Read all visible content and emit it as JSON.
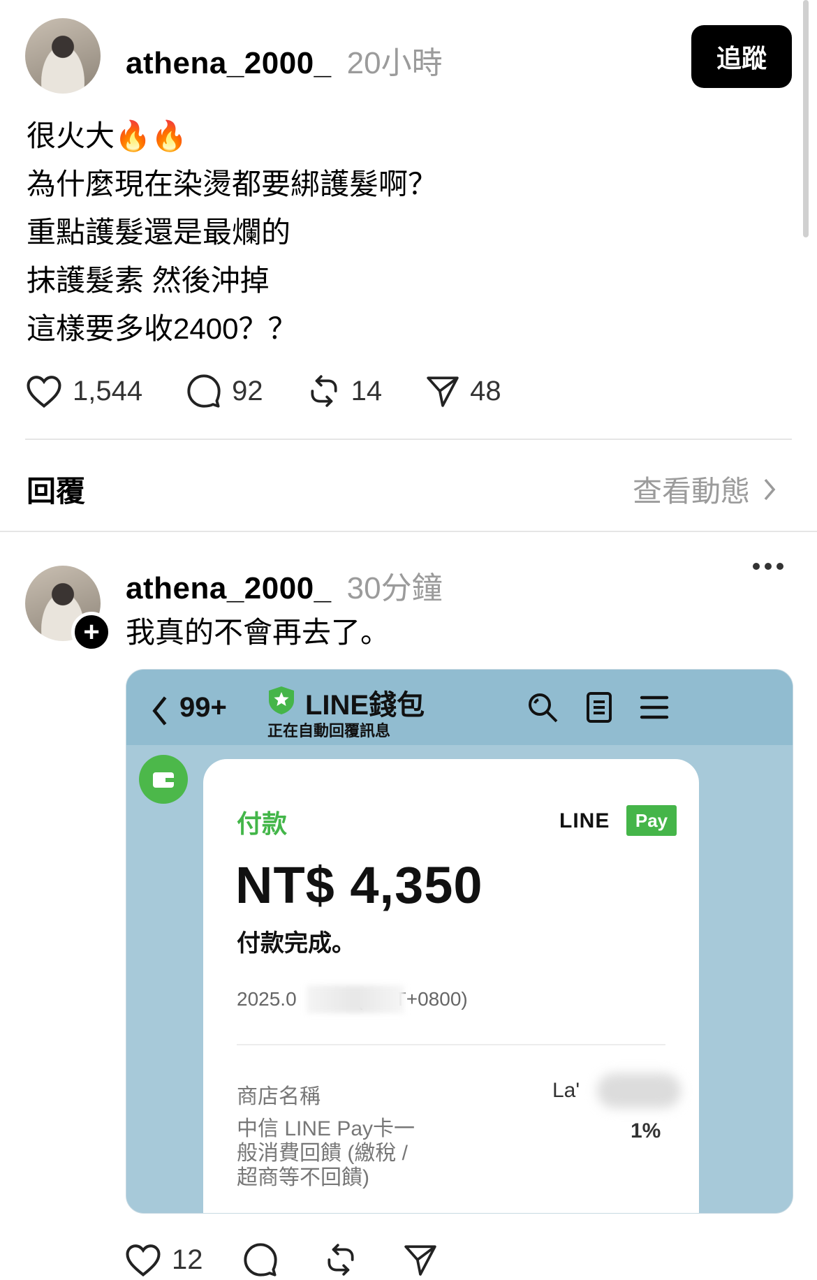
{
  "post": {
    "username": "athena_2000_",
    "time": "20小時",
    "follow_label": "追蹤",
    "text": "很火大🔥🔥\n為什麼現在染燙都要綁護髮啊？\n重點護髮還是最爛的\n抹護髮素 然後沖掉\n這樣要多收2400？？",
    "likes": "1,544",
    "comments": "92",
    "reposts": "14",
    "shares": "48"
  },
  "replies_header": {
    "title": "回覆",
    "activity_label": "查看動態"
  },
  "reply": {
    "username": "athena_2000_",
    "time": "30分鐘",
    "text": "我真的不會再去了。",
    "likes": "12",
    "attachment": {
      "unread_count": "99+",
      "chat_name": "LINE錢包",
      "chat_subtitle": "正在自動回覆訊息",
      "card_label": "付款",
      "brand_line": "LINE",
      "brand_pay": "Pay",
      "amount": "NT$ 4,350",
      "status": "付款完成。",
      "datetime": "2025.0           (GMT+0800)",
      "store_label": "商店名稱",
      "store_value": "La'",
      "cashback_label": "中信 LINE Pay卡一\n般消費回饋 (繳稅 /\n超商等不回饋)",
      "cashback_value": "1%"
    }
  },
  "colors": {
    "line_green": "#45b549",
    "chat_bg": "#a7c9d9",
    "muted_text": "#9b9b9b"
  }
}
